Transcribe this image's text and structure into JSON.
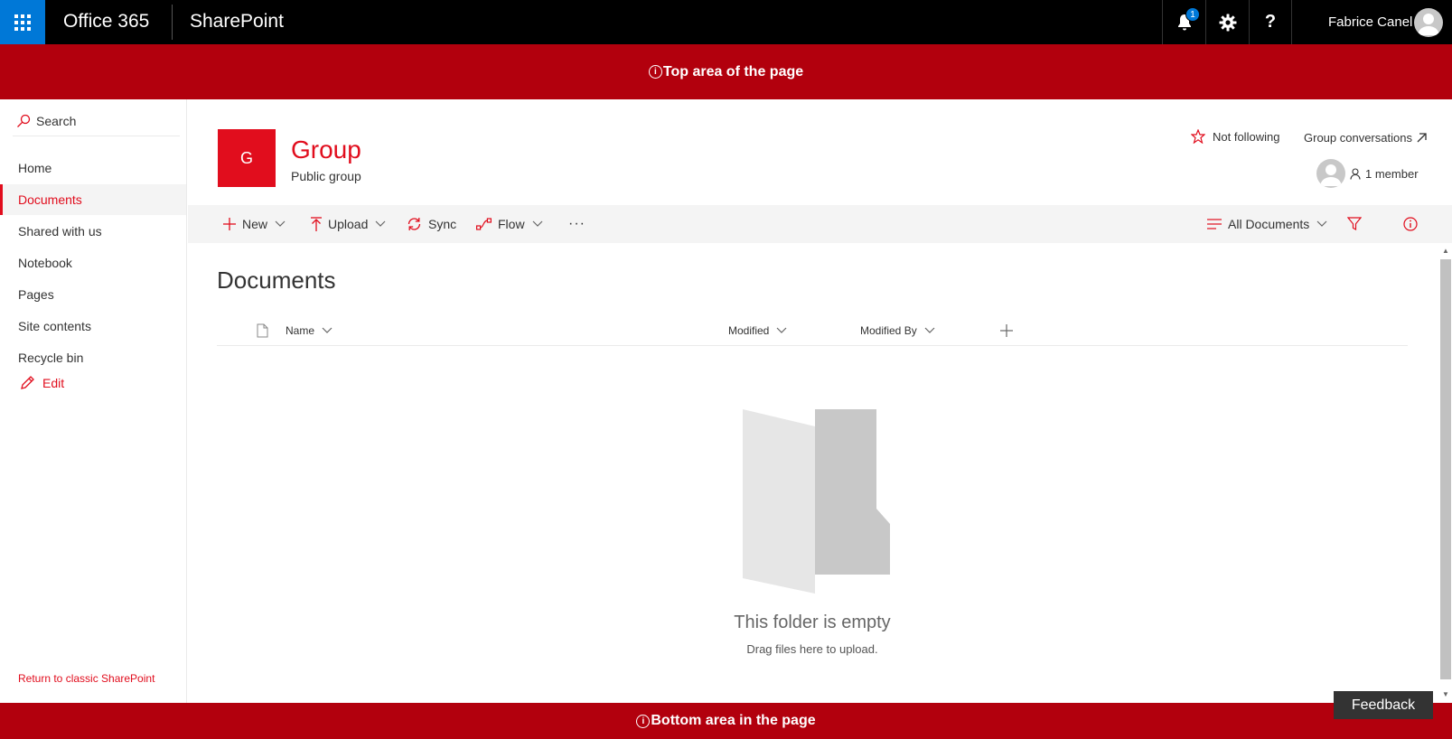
{
  "suitebar": {
    "brand": "Office 365",
    "app_name": "SharePoint",
    "notification_count": "1",
    "help_glyph": "?",
    "user_name": "Fabrice Canel"
  },
  "banners": {
    "top": "Top area of the page",
    "bottom": "Bottom area in the page"
  },
  "leftnav": {
    "search_label": "Search",
    "items": [
      {
        "label": "Home"
      },
      {
        "label": "Documents"
      },
      {
        "label": "Shared with us"
      },
      {
        "label": "Notebook"
      },
      {
        "label": "Pages"
      },
      {
        "label": "Site contents"
      },
      {
        "label": "Recycle bin"
      }
    ],
    "edit_label": "Edit",
    "classic_link": "Return to classic SharePoint"
  },
  "site": {
    "logo_letter": "G",
    "title": "Group",
    "subtitle": "Public group",
    "follow_label": "Not following",
    "conversations_label": "Group conversations",
    "members_label": "1 member"
  },
  "commandbar": {
    "new_label": "New",
    "upload_label": "Upload",
    "sync_label": "Sync",
    "flow_label": "Flow",
    "more_label": "···",
    "view_label": "All Documents"
  },
  "library": {
    "title": "Documents",
    "columns": {
      "name": "Name",
      "modified": "Modified",
      "modified_by": "Modified By"
    },
    "empty_title": "This folder is empty",
    "empty_subtitle": "Drag files here to upload."
  },
  "feedback_label": "Feedback",
  "colors": {
    "accent": "#e10d1d",
    "banner": "#b2000d",
    "waffle": "#0078d7",
    "suitebar": "#000000"
  }
}
